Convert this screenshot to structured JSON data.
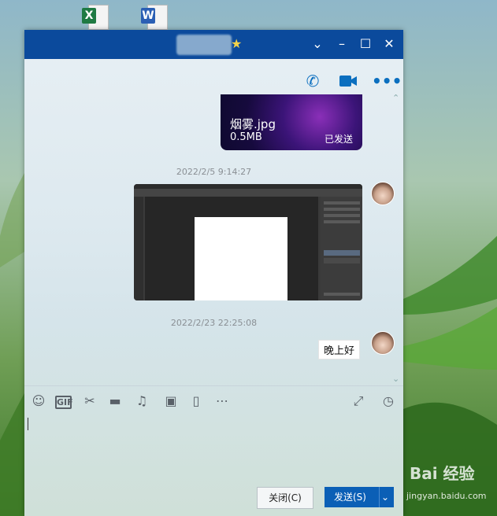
{
  "desktop": {
    "icons": [
      {
        "name": "excel-icon",
        "letter": "X",
        "color": "#1f7a43"
      },
      {
        "name": "word-icon",
        "letter": "W",
        "color": "#2b5fb4"
      }
    ],
    "watermark": "Bai 经验",
    "watermark_sub": "jingyan.baidu.com"
  },
  "window": {
    "titlebar": {
      "title_icon": "star-icon",
      "buttons": [
        "chevron-down-icon",
        "minimize-icon",
        "maximize-icon",
        "close-icon"
      ]
    },
    "header_actions": [
      "voice-call-icon",
      "video-call-icon",
      "more-icon"
    ],
    "messages": [
      {
        "type": "file",
        "file_name": "烟雾.jpg",
        "file_size": "0.5MB",
        "status": "已发送"
      },
      {
        "type": "timestamp",
        "text": "2022/2/5 9:14:27"
      },
      {
        "type": "image",
        "description_icon": "photoshop-screenshot"
      },
      {
        "type": "timestamp",
        "text": "2022/2/23 22:25:08"
      },
      {
        "type": "text",
        "text": "晚上好"
      }
    ],
    "toolbar": {
      "tools": [
        "emoji-icon",
        "gif-icon",
        "scissors-icon",
        "folder-icon",
        "music-icon",
        "image-icon",
        "screen-share-icon",
        "more-icon"
      ],
      "gif_label": "GIF",
      "right": [
        "expand-icon",
        "clock-icon"
      ]
    },
    "input": {
      "value": ""
    },
    "buttons": {
      "close_label": "关闭(C)",
      "send_label": "发送(S)"
    }
  },
  "colors": {
    "titlebar": "#0b4a9c",
    "send_button": "#0b5fb6",
    "accent": "#0b6fbf"
  }
}
